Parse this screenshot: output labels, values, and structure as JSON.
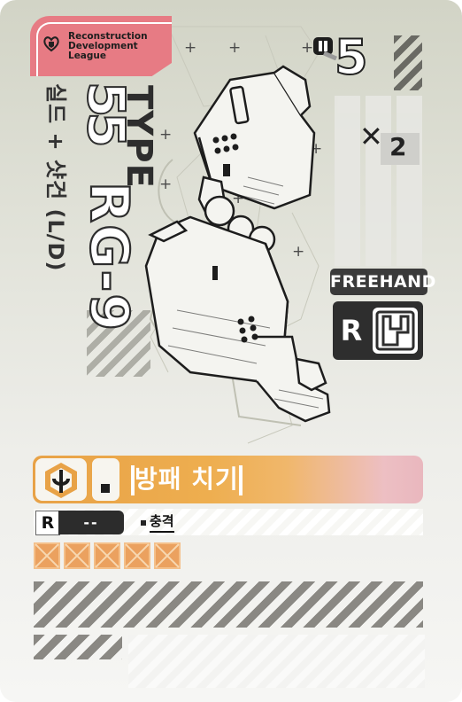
{
  "card": {
    "league": [
      "Reconstruction",
      "Development",
      "League"
    ],
    "weapon_name": "실드 + 샷건 (L/D)",
    "type_label": "TYPE",
    "type_number": "55",
    "model": "RG-9",
    "energy_cost": "5",
    "multiplier": "2",
    "hand_type": "FREEHAND",
    "slot_label": "R",
    "ability_name": "방패 치기",
    "range_label": "R",
    "range_value": "--",
    "tag": "충격",
    "pips": 5,
    "colors": {
      "league_badge": "#e77b84",
      "ability_bar": "#eeae4f",
      "pip": "#eba15f",
      "dark": "#2e2e2e"
    },
    "icons": [
      "league-logo-icon",
      "energy-icon",
      "multiplier-x-icon",
      "slot-shape-icon",
      "ability-hex-icon",
      "pip-cross-icon"
    ]
  }
}
